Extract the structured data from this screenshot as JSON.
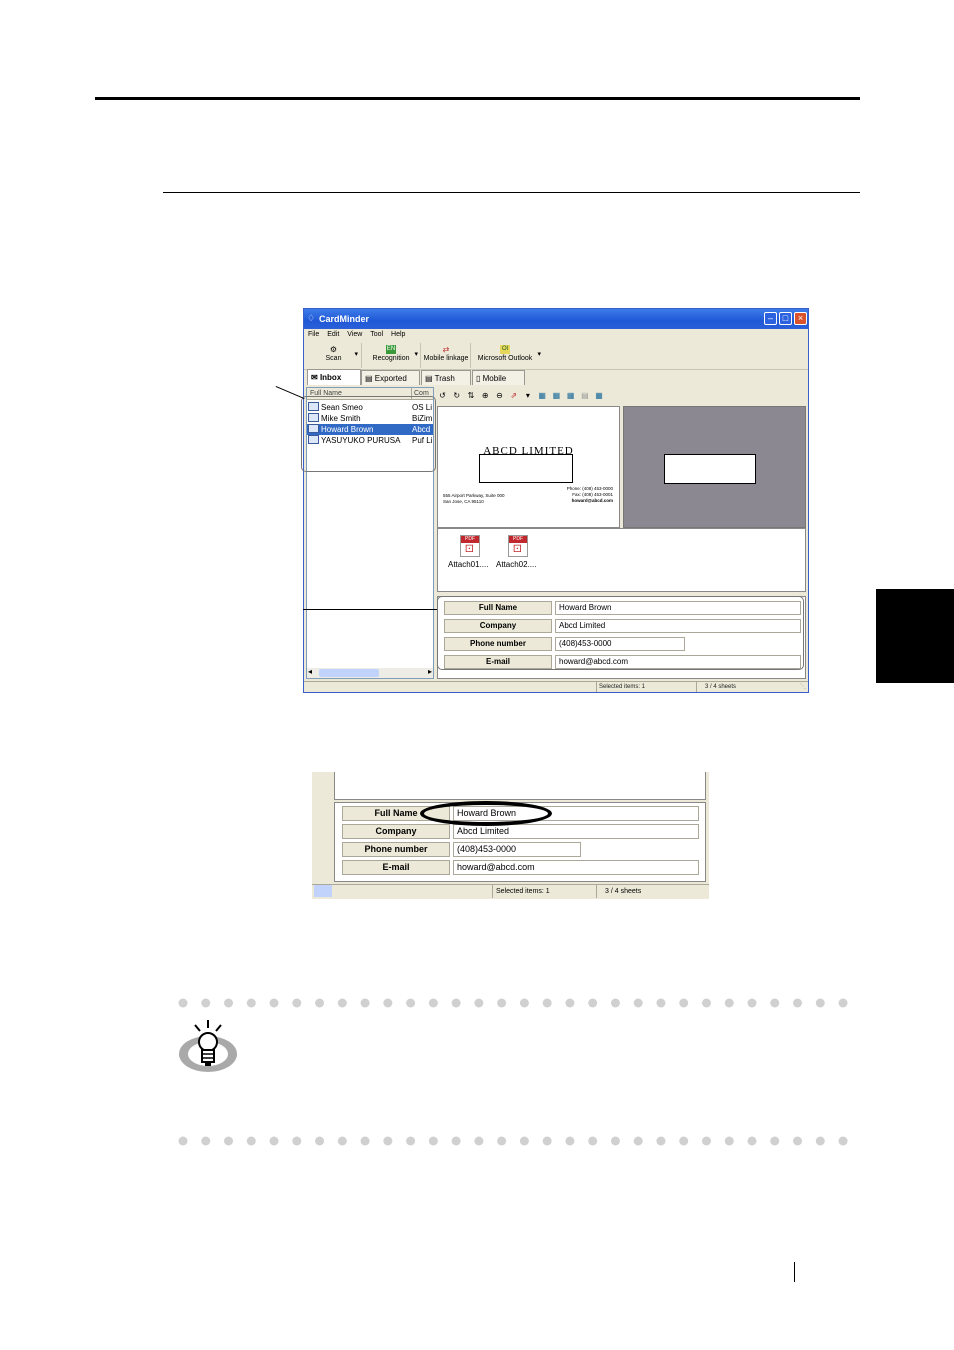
{
  "window": {
    "title": "CardMinder",
    "menu": [
      "File",
      "Edit",
      "View",
      "Tool",
      "Help"
    ],
    "toolbar": [
      "Scan",
      "Recognition",
      "Mobile linkage",
      "Microsoft Outlook"
    ],
    "tabs": [
      "Inbox",
      "Exported",
      "Trash",
      "Mobile"
    ],
    "list_header": "Full Name",
    "list_header_company": "Com",
    "rows": [
      {
        "name": "Sean Smeo",
        "company": "OS Li"
      },
      {
        "name": "Mike Smith",
        "company": "BiZim"
      },
      {
        "name": "Howard Brown",
        "company": "Abcd"
      },
      {
        "name": "YASUYUKO PURUSA",
        "company": "Puf Li"
      }
    ],
    "card": {
      "company": "ABCD LIMITED",
      "address_line1": "555 Airport Parkway, Suite 000",
      "address_line2": "San Jose, CA 95110",
      "phone": "Phone: (408) 453-0000",
      "fax": "Fax: (408) 453-0001",
      "email": "howard@abcd.com"
    },
    "attachments": [
      "Attach01....",
      "Attach02...."
    ],
    "fields": [
      {
        "label": "Full Name",
        "value": "Howard Brown"
      },
      {
        "label": "Company",
        "value": "Abcd Limited"
      },
      {
        "label": "Phone number",
        "value": "(408)453-0000"
      },
      {
        "label": "E-mail",
        "value": "howard@abcd.com"
      }
    ],
    "status_selected": "Selected items:   1",
    "status_sheets": "3 /    4 sheets"
  },
  "zoom": {
    "fields": [
      {
        "label": "Full Name",
        "value": "Howard Brown"
      },
      {
        "label": "Company",
        "value": "Abcd Limited"
      },
      {
        "label": "Phone number",
        "value": "(408)453-0000"
      },
      {
        "label": "E-mail",
        "value": "howard@abcd.com"
      }
    ],
    "status_selected": "Selected items:   1",
    "status_sheets": "3 /    4 sheets"
  }
}
